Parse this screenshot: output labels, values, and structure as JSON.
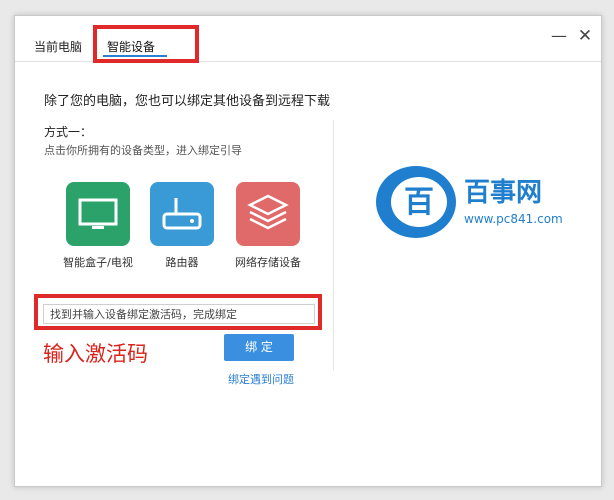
{
  "tabs": [
    {
      "label": "当前电脑"
    },
    {
      "label": "智能设备"
    }
  ],
  "window_controls": {
    "minimize": "—",
    "close": "✕"
  },
  "description": "除了您的电脑，您也可以绑定其他设备到远程下载",
  "method": {
    "title": "方式一：",
    "desc": "点击你所拥有的设备类型，进入绑定引导"
  },
  "devices": [
    {
      "label": "智能盒子/电视",
      "icon": "tv-icon",
      "color": "#2aa26a"
    },
    {
      "label": "路由器",
      "icon": "router-icon",
      "color": "#3a9ad6"
    },
    {
      "label": "网络存储设备",
      "icon": "storage-icon",
      "color": "#e06a6a"
    }
  ],
  "activation": {
    "placeholder": "找到并输入设备绑定激活码，完成绑定",
    "annotation": "输入激活码",
    "bind_label": "绑 定",
    "help_link": "绑定遇到问题"
  },
  "logo": {
    "glyph": "百",
    "name": "百事网",
    "url": "www.pc841.com"
  },
  "colors": {
    "accent": "#3a8fe0",
    "highlight": "#e02a2a",
    "logo": "#1f7fce"
  }
}
